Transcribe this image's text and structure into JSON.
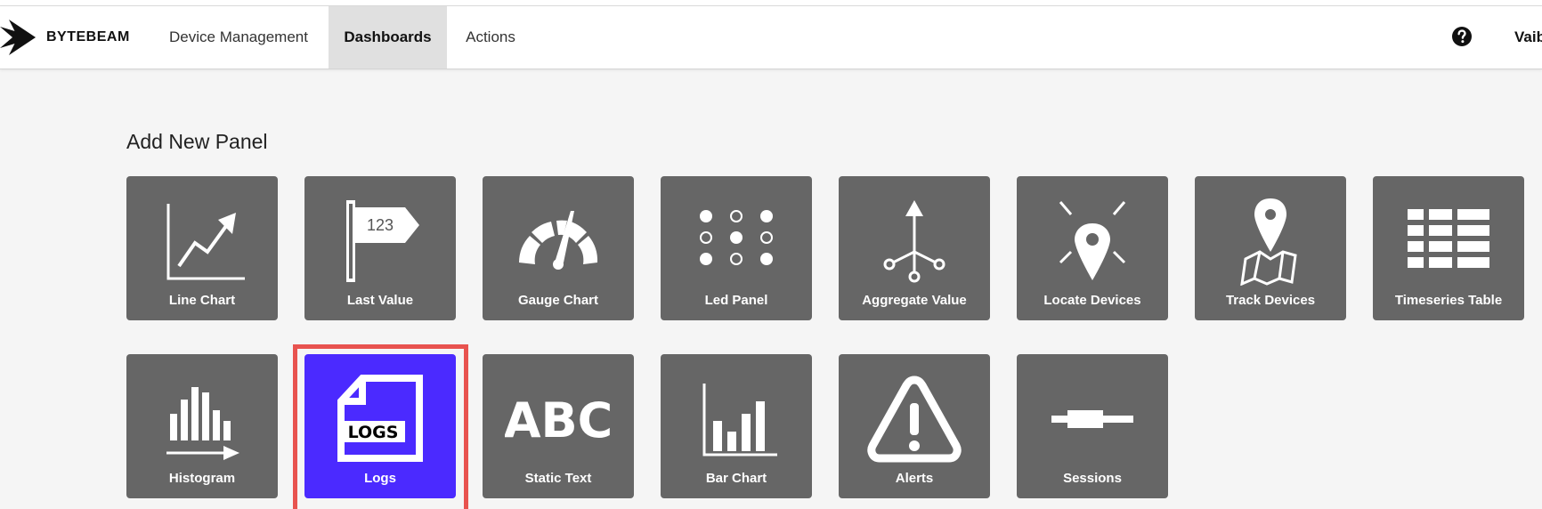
{
  "brand": {
    "name": "BYTEBEAM",
    "logo_icon": "bytebeam-logo-icon"
  },
  "nav": {
    "items": [
      {
        "label": "Device Management",
        "active": false
      },
      {
        "label": "Dashboards",
        "active": true
      },
      {
        "label": "Actions",
        "active": false
      }
    ],
    "help_icon": "question-circle-icon",
    "user_label": "Vaib"
  },
  "panel_picker": {
    "title": "Add New Panel",
    "selected": "Logs",
    "selected_color": "#4b2aff",
    "tile_color": "#666666",
    "highlight_color": "#e8534f",
    "tiles": [
      {
        "label": "Line Chart",
        "icon": "line-chart-icon"
      },
      {
        "label": "Last Value",
        "icon": "last-value-flag-icon",
        "icon_text": "123"
      },
      {
        "label": "Gauge Chart",
        "icon": "gauge-icon"
      },
      {
        "label": "Led Panel",
        "icon": "led-grid-icon"
      },
      {
        "label": "Aggregate Value",
        "icon": "aggregate-arrow-icon"
      },
      {
        "label": "Locate Devices",
        "icon": "map-pin-icon"
      },
      {
        "label": "Track Devices",
        "icon": "map-track-icon"
      },
      {
        "label": "Timeseries Table",
        "icon": "table-icon"
      },
      {
        "label": "Histogram",
        "icon": "histogram-icon"
      },
      {
        "label": "Logs",
        "icon": "logs-document-icon",
        "icon_text": "LOGS"
      },
      {
        "label": "Static Text",
        "icon": "abc-text-icon",
        "icon_text": "ABC"
      },
      {
        "label": "Bar Chart",
        "icon": "bar-chart-icon"
      },
      {
        "label": "Alerts",
        "icon": "alert-triangle-icon"
      },
      {
        "label": "Sessions",
        "icon": "sessions-line-icon"
      }
    ]
  }
}
